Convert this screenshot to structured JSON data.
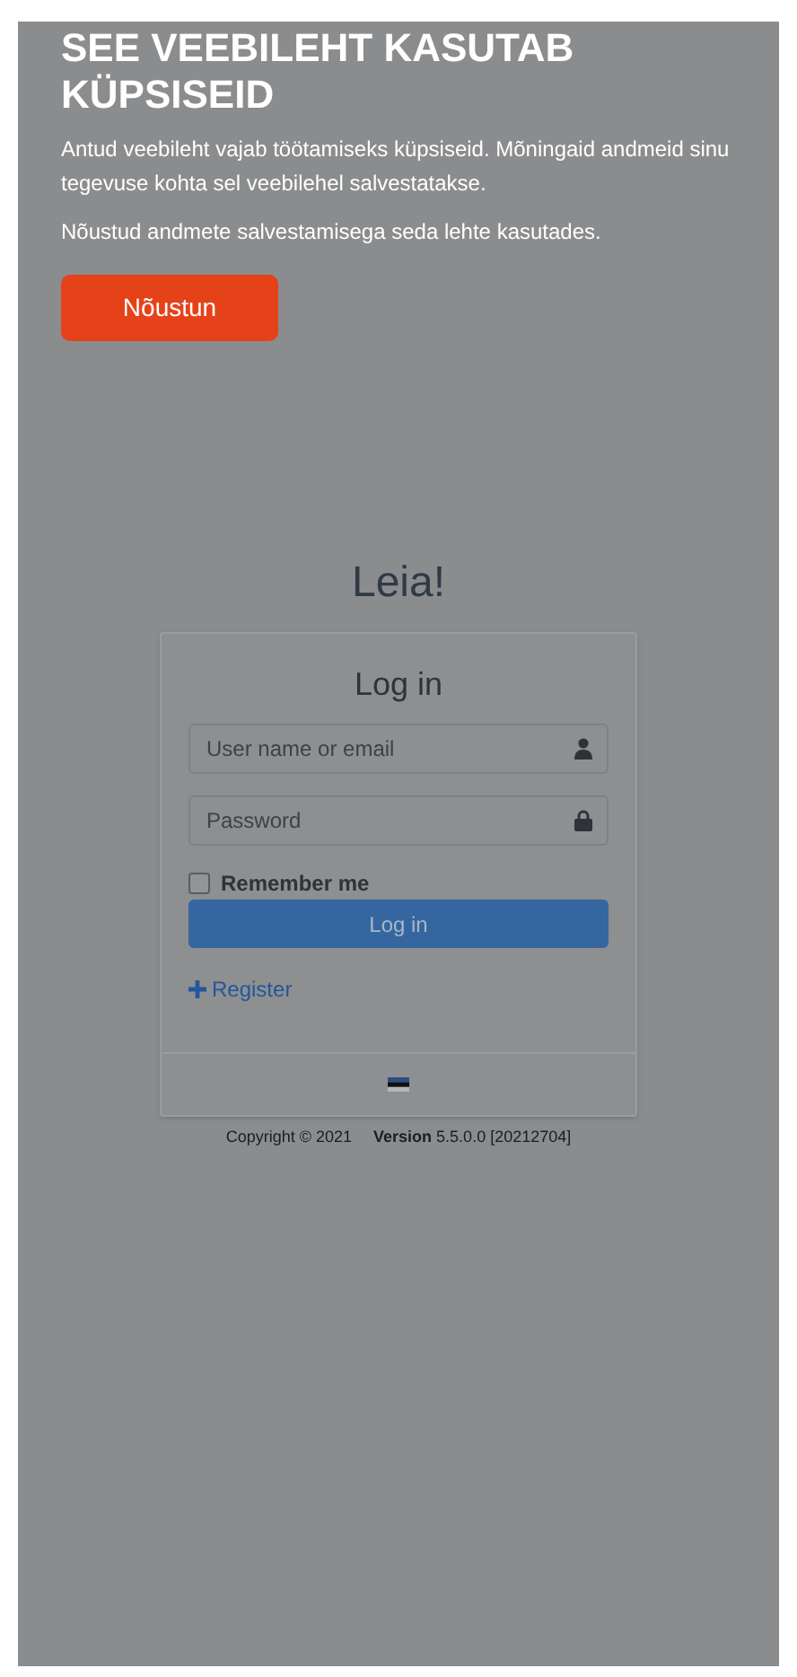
{
  "cookie_banner": {
    "title": "SEE VEEBILEHT KASUTAB KÜPSISEID",
    "paragraphs": [
      "Antud veebileht vajab töötamiseks küpsiseid. Mõningaid andmeid sinu tegevuse kohta sel veebilehel salvestatakse.",
      "Nõustud andmete salvestamisega seda lehte kasutades."
    ],
    "accept_button": "Nõustun"
  },
  "realm_title": "Leia!",
  "login": {
    "title": "Log in",
    "username": {
      "placeholder": "User name or email"
    },
    "password": {
      "placeholder": "Password"
    },
    "remember_me": {
      "label": "Remember me",
      "checked": false
    },
    "submit": "Log in",
    "register_link": "Register"
  },
  "footer": {
    "copyright": "Copyright © 2021",
    "version": "**Version** 5.5.0.0 [20212704]"
  }
}
